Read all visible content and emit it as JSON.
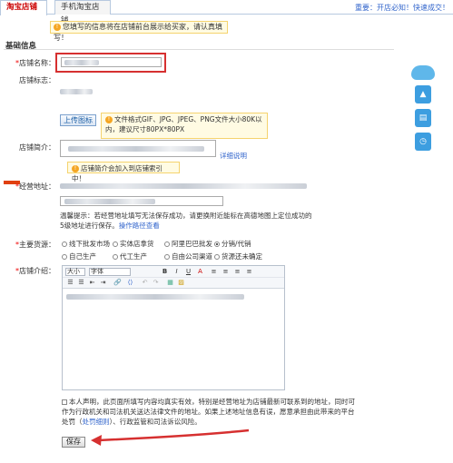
{
  "tabs": [
    {
      "label": "淘宝店铺"
    },
    {
      "label": "手机淘宝店铺"
    }
  ],
  "top_notice": "重要：开店必知！快速成交！",
  "notice": "您填写的信息将在店铺前台展示给买家，请认真填写！",
  "section_title": "基础信息",
  "fields": {
    "shop_name_label": "店铺名称：",
    "shop_logo_label": "店铺标志：",
    "upload_label": "上传图标",
    "logo_tip": "文件格式GIF、JPG、JPEG、PNG文件大小80K以内，建议尺寸80PX*80PX",
    "intro_label": "店铺简介：",
    "detail_link": "详细说明",
    "intro_tip": "店铺简介会加入到店铺索引中！",
    "address_label": "经营地址：",
    "address_hint": "温馨提示：若经营地址填写无法保存成功，请更换附近能标在高德地图上定位成功的5级地址进行保存。",
    "address_link": "操作路径查看",
    "source_label": "主要货源：",
    "source_options": [
      {
        "label": "线下批发市场",
        "selected": false
      },
      {
        "label": "实体店拿货",
        "selected": false
      },
      {
        "label": "阿里巴巴批发",
        "selected": false
      },
      {
        "label": "分销/代销",
        "selected": true
      },
      {
        "label": "自己生产",
        "selected": false
      },
      {
        "label": "代工生产",
        "selected": false
      },
      {
        "label": "自由公司渠道",
        "selected": false
      },
      {
        "label": "货源还未确定",
        "selected": false
      }
    ],
    "shop_intro_label": "店铺介绍："
  },
  "editor": {
    "font_size": "大小",
    "font_family": "字体",
    "toolbar_row1": [
      "B",
      "I",
      "U",
      "A",
      "≡",
      "≡",
      "≡",
      "≡"
    ],
    "toolbar_row2": [
      "☰",
      "☰",
      "⇤",
      "⇥",
      "🔗",
      "⟨⟩",
      "↶",
      "↷",
      "▦",
      "▨"
    ]
  },
  "declaration": {
    "line1": "本人声明，此页面所填写内容均真实有效，特别是经营地址为店铺最新可联系到的地址，同时可",
    "line2": "作为行政机关和司法机关送达法律文件的地址。如果上述地址信息有误，愿意承担由此带来的平台",
    "line3_prefix": "处罚（",
    "line3_link": "处罚细则",
    "line3_suffix": "）、行政监管和司法诉讼风险。"
  },
  "save_label": "保存",
  "colors": {
    "accent": "#3366cc",
    "alert": "#d63030",
    "tip_bg": "#fffbe3"
  }
}
